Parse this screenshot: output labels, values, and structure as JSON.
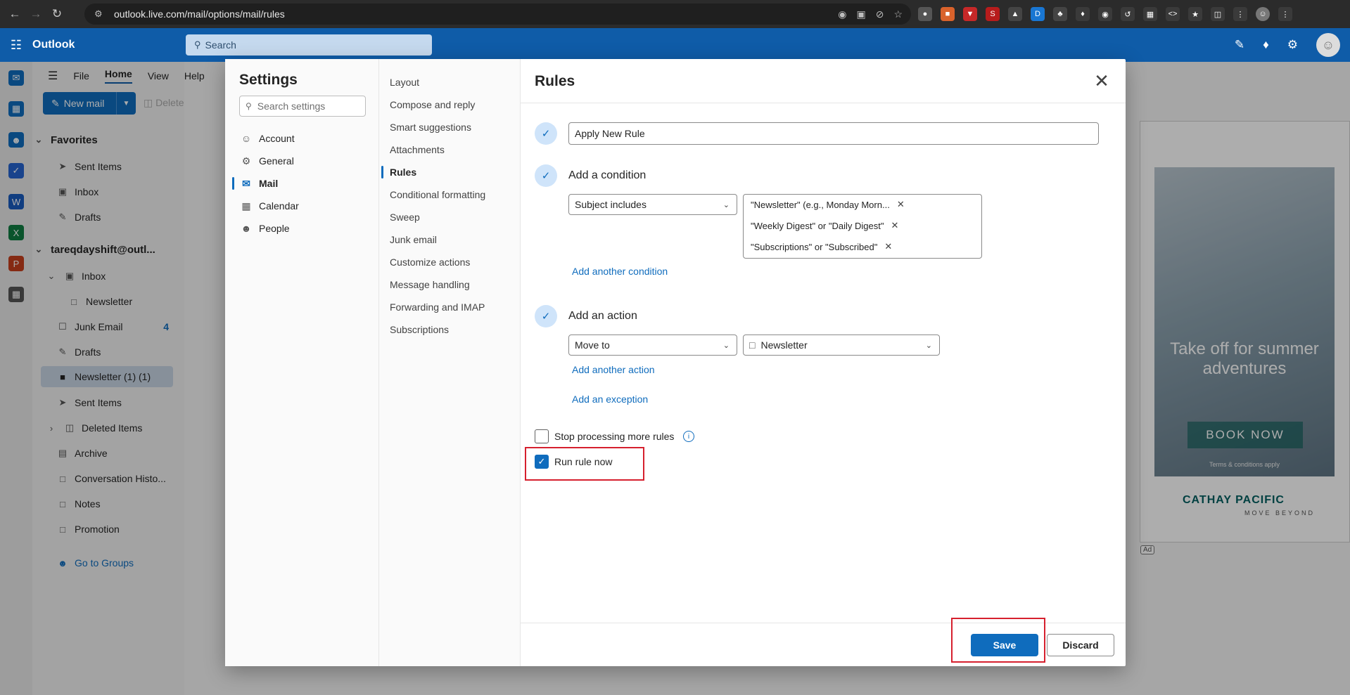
{
  "browser": {
    "url": "outlook.live.com/mail/options/mail/rules"
  },
  "header": {
    "app_name": "Outlook",
    "search_placeholder": "Search"
  },
  "ribbon": {
    "tabs": [
      "File",
      "Home",
      "View",
      "Help"
    ],
    "new_mail": "New mail",
    "delete": "Delete"
  },
  "folders": {
    "favorites_label": "Favorites",
    "favorites": [
      "Sent Items",
      "Inbox",
      "Drafts"
    ],
    "account": "tareqdayshift@outl...",
    "items": [
      {
        "label": "Inbox"
      },
      {
        "label": "Newsletter"
      },
      {
        "label": "Junk Email",
        "count": "4"
      },
      {
        "label": "Drafts"
      },
      {
        "label": "Newsletter (1) (1)"
      },
      {
        "label": "Sent Items"
      },
      {
        "label": "Deleted Items"
      },
      {
        "label": "Archive"
      },
      {
        "label": "Conversation Histo..."
      },
      {
        "label": "Notes"
      },
      {
        "label": "Promotion"
      }
    ],
    "groups_link": "Go to Groups"
  },
  "settings": {
    "title": "Settings",
    "search_placeholder": "Search settings",
    "categories": [
      "Account",
      "General",
      "Mail",
      "Calendar",
      "People"
    ],
    "selected_category": "Mail",
    "mail_sections": [
      "Layout",
      "Compose and reply",
      "Smart suggestions",
      "Attachments",
      "Rules",
      "Conditional formatting",
      "Sweep",
      "Junk email",
      "Customize actions",
      "Message handling",
      "Forwarding and IMAP",
      "Subscriptions"
    ],
    "selected_section": "Rules"
  },
  "rules": {
    "title": "Rules",
    "rule_name": "Apply New Rule",
    "condition_label": "Add a condition",
    "condition_type": "Subject includes",
    "condition_values": [
      "\"Newsletter\" (e.g., Monday Morn...",
      "\"Weekly Digest\" or \"Daily Digest\"",
      "\"Subscriptions\" or \"Subscribed\""
    ],
    "add_condition_link": "Add another condition",
    "action_label": "Add an action",
    "action_type": "Move to",
    "action_folder": "Newsletter",
    "add_action_link": "Add another action",
    "add_exception_link": "Add an exception",
    "stop_processing_label": "Stop processing more rules",
    "stop_processing_checked": false,
    "run_now_label": "Run rule now",
    "run_now_checked": true,
    "save_label": "Save",
    "discard_label": "Discard"
  },
  "ad": {
    "headline": "Take off for summer adventures",
    "cta": "BOOK NOW",
    "terms": "Terms & conditions apply",
    "brand": "CATHAY PACIFIC",
    "tagline": "MOVE BEYOND",
    "marker": "Ad"
  },
  "colors": {
    "brand_blue": "#0f6cbd",
    "header_blue": "#0f5ca8",
    "highlight_red": "#d6202e"
  }
}
